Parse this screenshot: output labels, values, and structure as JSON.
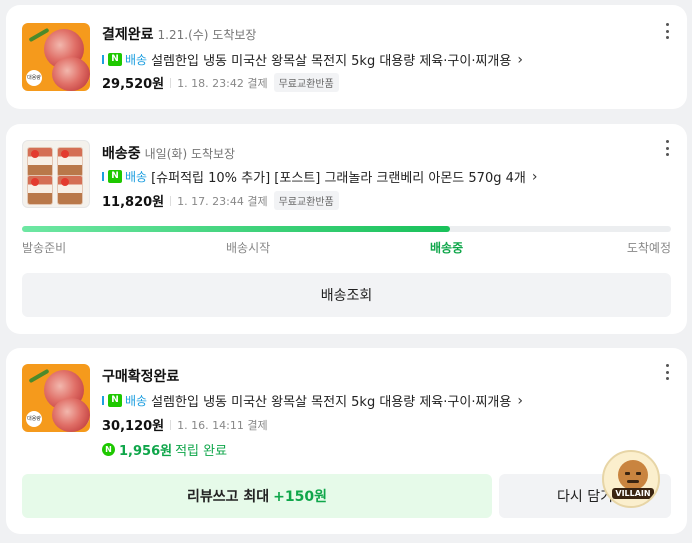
{
  "orders": [
    {
      "status": "결제완료",
      "status_sub": "1.21.(수) 도착보장",
      "delivery_badge": "배송",
      "product_name": "설렘한입 냉동 미국산 왕목살 목전지 5kg 대용량 제육·구이·찌개용",
      "price": "29,520원",
      "pay_date": "1. 18. 23:42 결제",
      "tag": "무료교환반품",
      "thumb_badge": "대용량"
    },
    {
      "status": "배송중",
      "status_sub": "내일(화) 도착보장",
      "delivery_badge": "배송",
      "product_name": "[슈퍼적립 10% 추가] [포스트] 그래놀라 크랜베리 아몬드 570g 4개",
      "price": "11,820원",
      "pay_date": "1. 17. 23:44 결제",
      "tag": "무료교환반품",
      "progress": {
        "fraction": 0.66,
        "steps": [
          "발송준비",
          "배송시작",
          "배송중",
          "도착예정"
        ],
        "active_index": 2
      },
      "track_button": "배송조회"
    },
    {
      "status": "구매확정완료",
      "delivery_badge": "배송",
      "product_name": "설렘한입 냉동 미국산 왕목살 목전지 5kg 대용량 제육·구이·찌개용",
      "price": "30,120원",
      "pay_date": "1. 16. 14:11 결제",
      "points_icon": "N",
      "points_amount": "1,956원",
      "points_suffix": "적립 완료",
      "thumb_badge": "대용량",
      "review_button": "리뷰쓰고 최대",
      "review_bonus": "+150원",
      "rebuy_button": "다시 담기"
    }
  ],
  "icons": {
    "delivery_n": "N",
    "chevron": "›"
  },
  "mascot_label": "VILLAIN",
  "colors": {
    "accent_green": "#0fa64a",
    "delivery_blue": "#1e9fe0",
    "naver_green": "#1ec800"
  }
}
